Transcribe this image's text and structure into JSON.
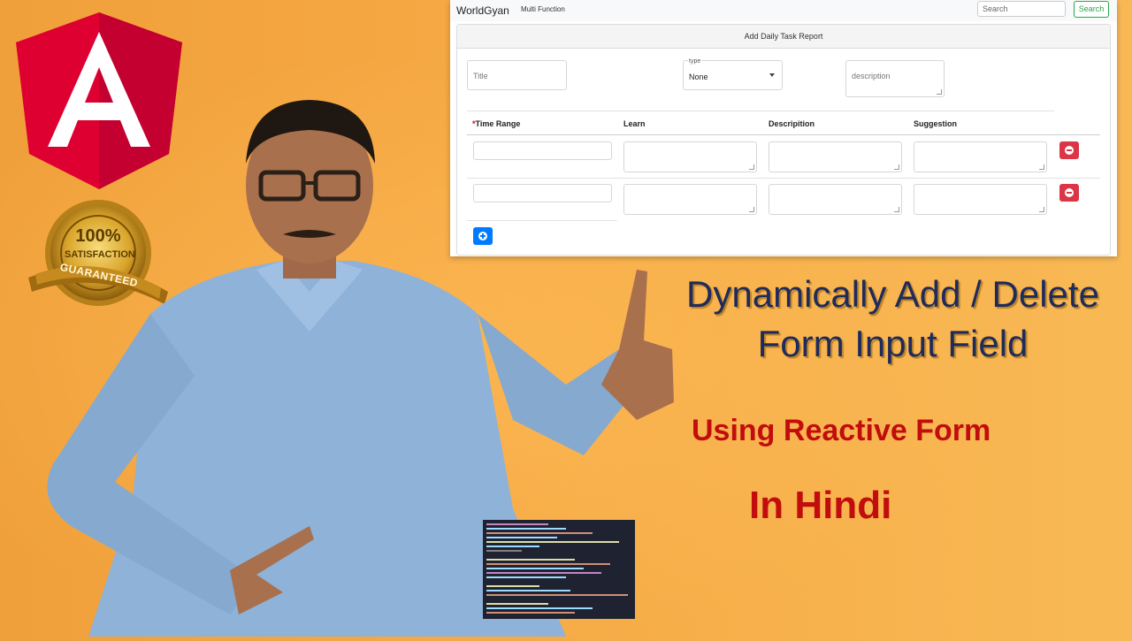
{
  "app": {
    "brand": "WorldGyan",
    "nav_link": "Multi Function",
    "search_placeholder": "Search",
    "search_button": "Search",
    "card_title": "Add Daily Task Report",
    "title_placeholder": "Title",
    "type_label": "type",
    "type_value": "None",
    "description_placeholder": "description",
    "columns": [
      "Time Range",
      "Learn",
      "Descripition",
      "Suggestion"
    ],
    "required_mark": "*"
  },
  "thumbnail": {
    "headline_line1": "Dynamically Add / Delete",
    "headline_line2": "Form Input Field",
    "subtitle": "Using Reactive Form",
    "language": "In Hindi"
  },
  "badge": {
    "percent": "100%",
    "line": "SATISFACTION",
    "ribbon": "GUARANTEED"
  },
  "colors": {
    "angular_red": "#dd0031",
    "danger": "#dc3545",
    "primary": "#007bff",
    "success": "#28a745",
    "headline": "#1e2b5c",
    "subtitle": "#c10d0d"
  }
}
